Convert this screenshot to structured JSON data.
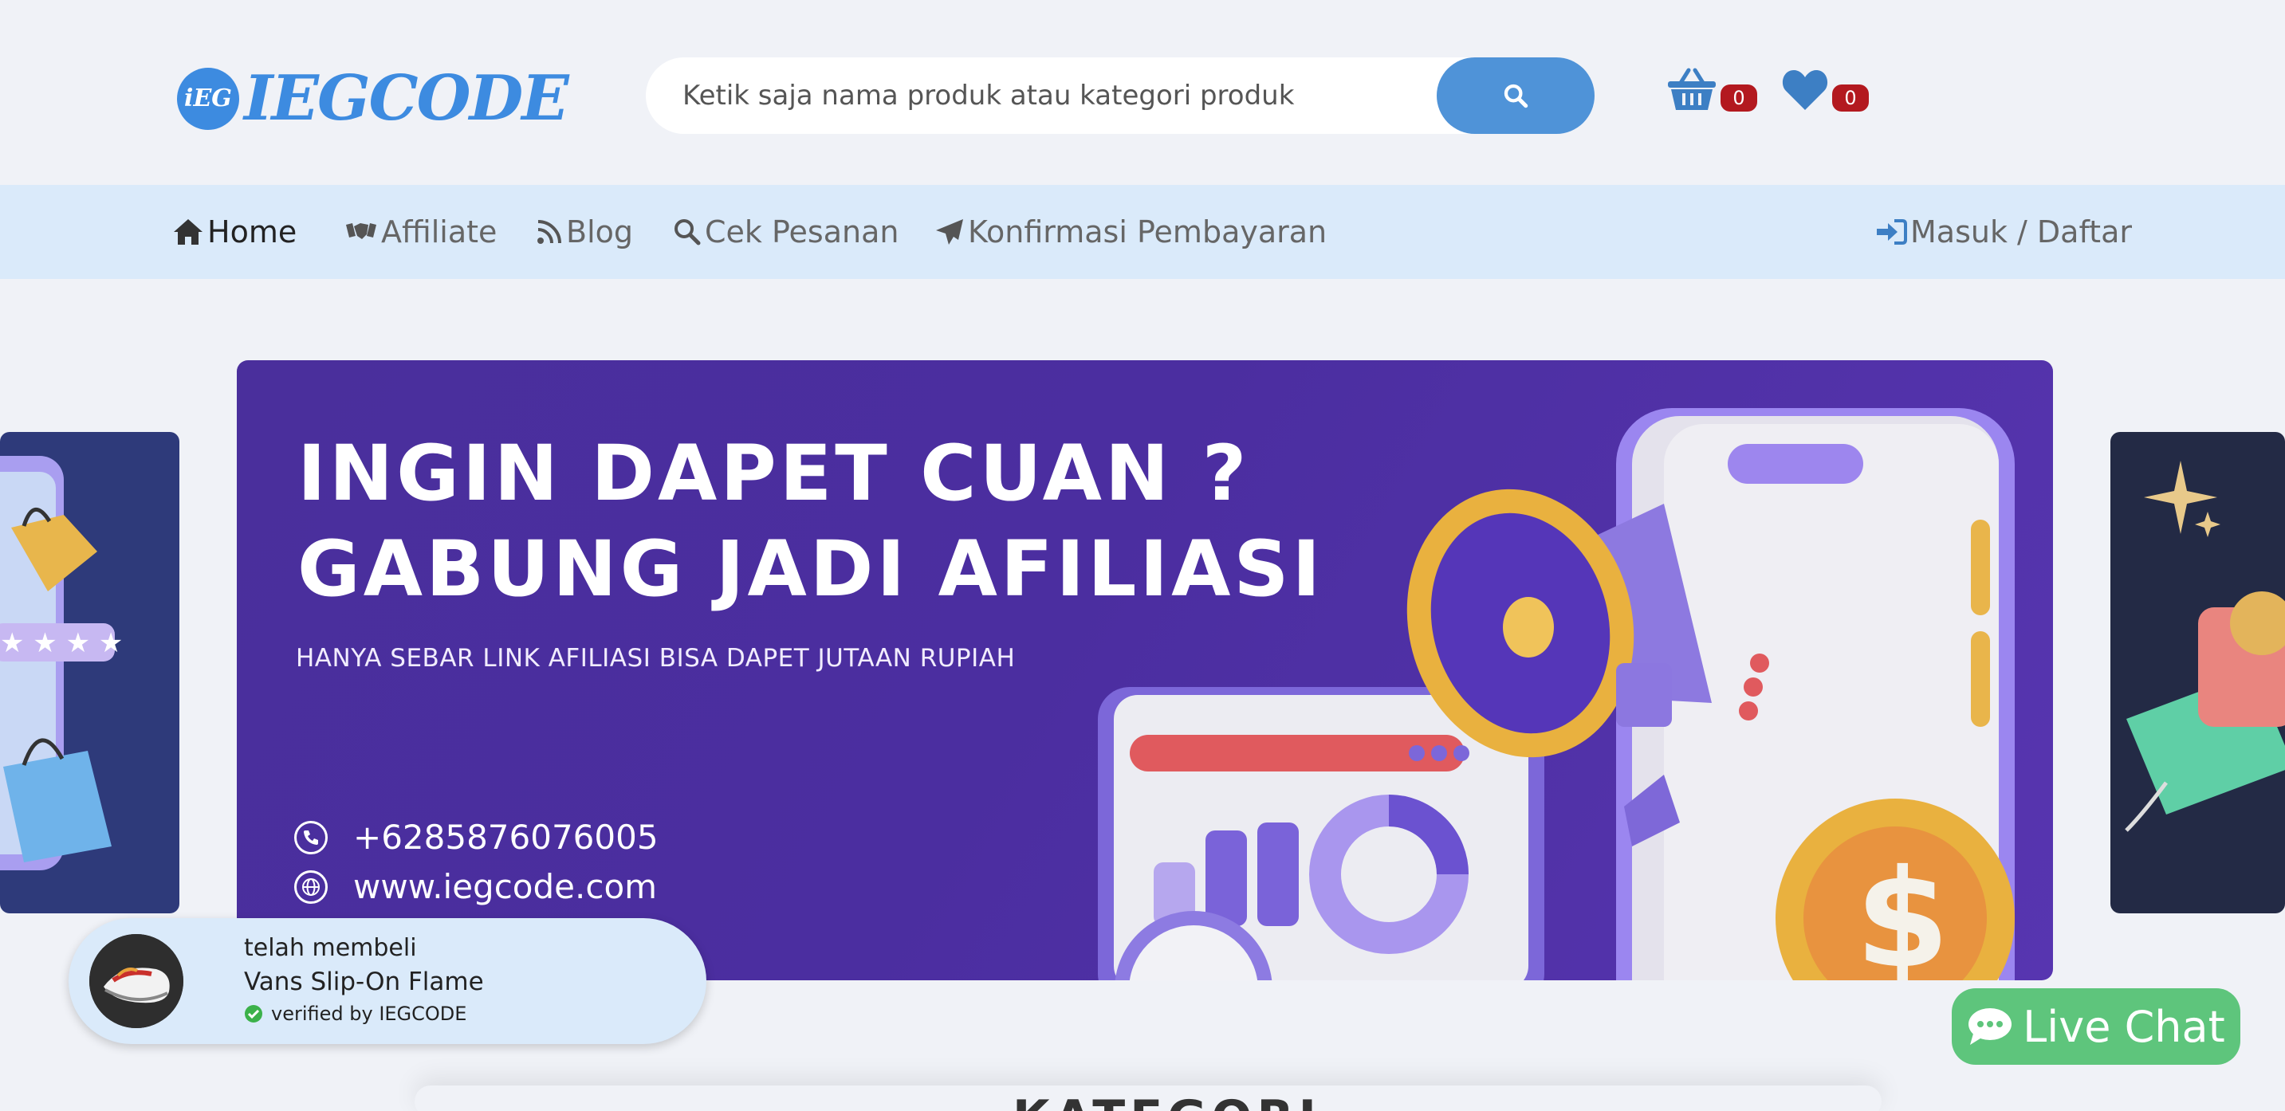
{
  "header": {
    "logo_badge": "iEG",
    "logo_text": "IEGCODE",
    "search_placeholder": "Ketik saja nama produk atau kategori produk",
    "cart_count": "0",
    "wishlist_count": "0"
  },
  "nav": {
    "home": "Home",
    "affiliate": "Affiliate",
    "blog": "Blog",
    "cek_pesanan": "Cek Pesanan",
    "konfirmasi": "Konfirmasi Pembayaran",
    "login": "Masuk / Daftar"
  },
  "banner": {
    "title_line1": "INGIN DAPET CUAN ?",
    "title_line2": "GABUNG JADI AFILIASI",
    "subtitle": "HANYA SEBAR LINK AFILIASI BISA DAPET JUTAAN RUPIAH",
    "phone": "+6285876076005",
    "website": "www.iegcode.com"
  },
  "toast": {
    "line1": "telah membeli",
    "product": "Vans Slip-On Flame",
    "verified": "verified by IEGCODE"
  },
  "livechat": {
    "label": "Live Chat"
  },
  "section": {
    "title": "KATEGORI"
  },
  "colors": {
    "accent": "#4f93d8",
    "nav_bg": "#daeafa",
    "badge": "#b3191f",
    "banner": "#4a2f9c",
    "live_chat": "#5ec57c"
  }
}
